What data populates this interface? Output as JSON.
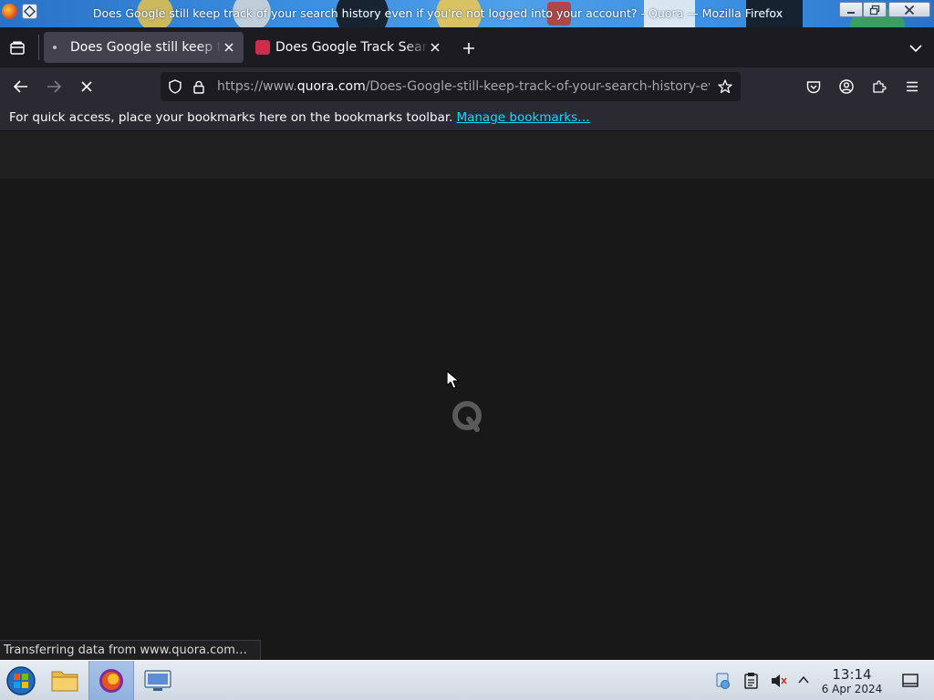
{
  "window": {
    "title": "Does Google still keep track of your search history even if you're not logged into your account? - Quora — Mozilla Firefox"
  },
  "tabs": [
    {
      "title": "Does Google still keep track of your search history even if you're not logged into your account?",
      "active": true
    },
    {
      "title": "Does Google Track Search History in Incognito?",
      "active": false
    }
  ],
  "navbar": {
    "url_prefix": "https://www.",
    "url_host": "quora.com",
    "url_path": "/Does-Google-still-keep-track-of-your-search-history-even-if-youre-not-logged-into-your-account"
  },
  "bookmarks_bar": {
    "message": "For quick access, place your bookmarks here on the bookmarks toolbar.",
    "manage_link": "Manage bookmarks…"
  },
  "status_bar": {
    "text": "Transferring data from www.quora.com…"
  },
  "taskbar": {
    "time": "13:14",
    "date": "6 Apr 2024"
  },
  "colors": {
    "accent_link": "#00ddff",
    "toolbar": "#2b2a33",
    "tab_active": "#42414d",
    "content_bg": "#181818"
  }
}
